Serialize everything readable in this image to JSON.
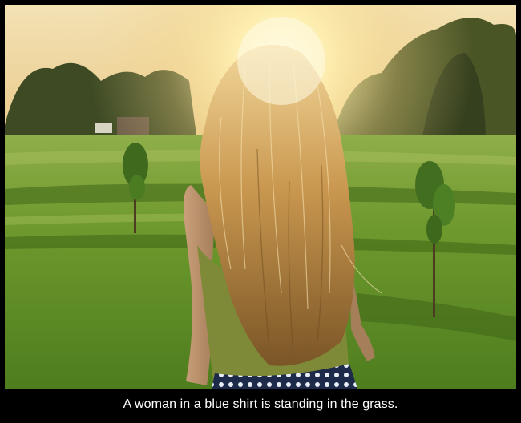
{
  "caption": "A woman in a blue shirt is standing in the grass.",
  "colors": {
    "frame": "#000000",
    "caption_text": "#ffffff",
    "sky": "#f7e6b8",
    "sun": "#fff8d0",
    "grass": "#6e9a2c",
    "trees": "#3e4a22",
    "hair": "#c99a55"
  }
}
